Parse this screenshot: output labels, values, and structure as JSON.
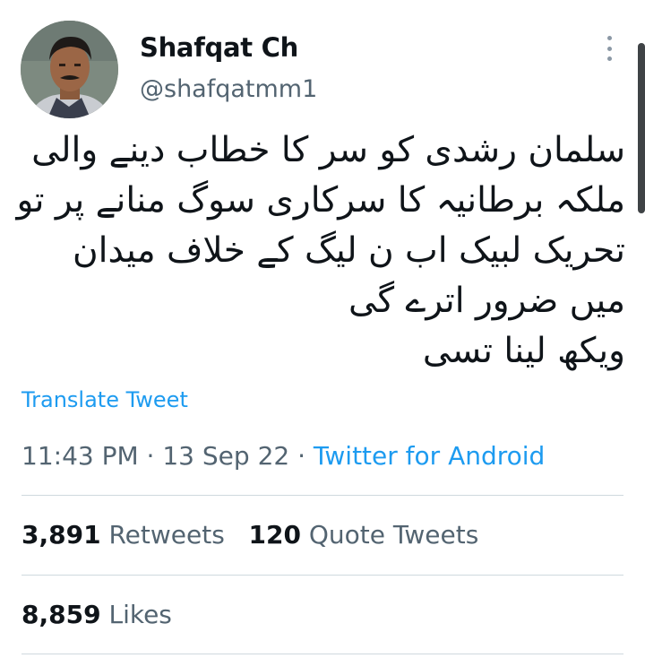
{
  "author": {
    "name": "Shafqat Ch",
    "handle": "@shafqatmm1"
  },
  "tweet": {
    "lines": [
      "سلمان رشدی کو سر کا خطاب دینے والی",
      "ملکہ برطانیہ کا سرکاری سوگ منانے پر تو",
      "تحریک لبیک اب ن لیگ کے خلاف میدان",
      "میں ضرور اترے گی",
      "ویکھ لینا تسی"
    ],
    "translate_label": "Translate Tweet",
    "time": "11:43 PM",
    "date": "13 Sep 22",
    "separator": "·",
    "source": "Twitter for Android"
  },
  "stats": {
    "retweets_count": "3,891",
    "retweets_label": "Retweets",
    "quotes_count": "120",
    "quotes_label": "Quote Tweets",
    "likes_count": "8,859",
    "likes_label": "Likes"
  },
  "icons": {
    "more": "more-vertical-icon"
  },
  "colors": {
    "link": "#1d9bf0",
    "secondary_text": "#536471",
    "primary_text": "#0f1419",
    "divider": "#cfd9de"
  }
}
